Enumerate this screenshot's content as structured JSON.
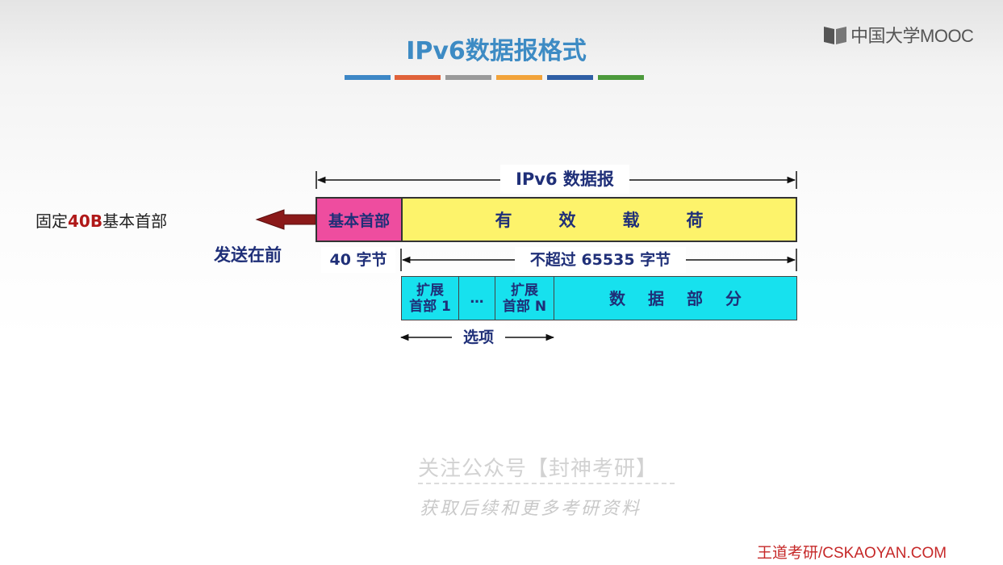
{
  "title": "IPv6数据报格式",
  "title_strip_colors": [
    "#3d87c6",
    "#e0623a",
    "#9a9a9a",
    "#f2a33a",
    "#2f5fa5",
    "#4c9a3c"
  ],
  "logo": {
    "icon": "book-icon",
    "text": "中国大学MOOC"
  },
  "annotations": {
    "fixed_prefix": "固定",
    "fixed_highlight": "40B",
    "fixed_suffix": "基本首部",
    "send_first": "发送在前"
  },
  "diagram": {
    "datagram_label": "IPv6 数据报",
    "base_header": "基本首部",
    "payload_chars": [
      "有",
      "效",
      "载",
      "荷"
    ],
    "base_header_size": "40 字节",
    "payload_size": "不超过 65535 字节",
    "ext_header_1_line1": "扩展",
    "ext_header_1_line2": "首部 1",
    "ellipsis": "…",
    "ext_header_n_line1": "扩展",
    "ext_header_n_line2": "首部 N",
    "data_part_chars": [
      "数",
      "据",
      "部",
      "分"
    ],
    "options_label": "选项"
  },
  "watermark": {
    "line1": "关注公众号【封神考研】",
    "line2": "获取后续和更多考研资料"
  },
  "footer": {
    "brand": "王道考研/CSKAOYAN.COM"
  },
  "colors": {
    "base_header_fill": "#ee4d9f",
    "payload_fill": "#fdf36b",
    "ext_fill": "#17e1ee",
    "arrow_fill": "#8b1a1a",
    "label_text": "#1f2f78"
  }
}
